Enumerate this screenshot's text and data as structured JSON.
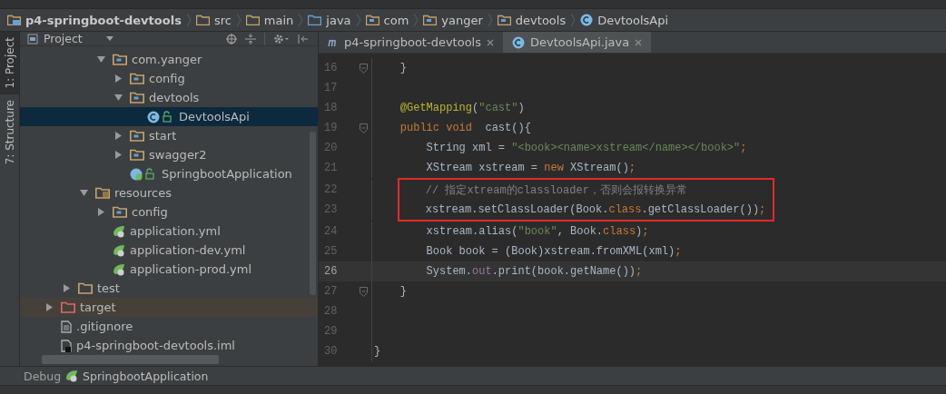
{
  "breadcrumbs": [
    {
      "kind": "project",
      "label": "p4-springboot-devtools"
    },
    {
      "kind": "folder",
      "label": "src"
    },
    {
      "kind": "folder",
      "label": "main"
    },
    {
      "kind": "source",
      "label": "java"
    },
    {
      "kind": "package",
      "label": "com"
    },
    {
      "kind": "package",
      "label": "yanger"
    },
    {
      "kind": "package",
      "label": "devtools"
    },
    {
      "kind": "class",
      "label": "DevtoolsApi"
    }
  ],
  "tool_strip": [
    {
      "label": "1: Project",
      "selected": true
    },
    {
      "label": "7: Structure",
      "selected": false
    }
  ],
  "project_panel": {
    "title": "Project",
    "tree": [
      {
        "children": [
          {
            "children": [
              {
                "children": [
                  {
                    "kind": "package",
                    "label": "com.yanger",
                    "expanded": true,
                    "selected": false,
                    "children": [
                      {
                        "kind": "package",
                        "label": "config",
                        "expanded": false,
                        "selected": false
                      },
                      {
                        "kind": "package",
                        "label": "devtools",
                        "expanded": true,
                        "selected": false,
                        "children": [
                          {
                            "kind": "class",
                            "label": "DevtoolsApi",
                            "selected": true
                          }
                        ]
                      },
                      {
                        "kind": "package",
                        "label": "start",
                        "expanded": false,
                        "selected": false
                      },
                      {
                        "kind": "package",
                        "label": "swagger2",
                        "expanded": false,
                        "selected": false
                      },
                      {
                        "kind": "spring-class",
                        "label": "SpringbootApplication",
                        "selected": false
                      }
                    ]
                  }
                ]
              },
              {
                "kind": "resources",
                "label": "resources",
                "expanded": true,
                "selected": false,
                "children": [
                  {
                    "kind": "package",
                    "label": "config",
                    "expanded": false,
                    "selected": false
                  },
                  {
                    "kind": "spring-config",
                    "label": "application.yml",
                    "selected": false
                  },
                  {
                    "kind": "spring-config",
                    "label": "application-dev.yml",
                    "selected": false
                  },
                  {
                    "kind": "spring-config",
                    "label": "application-prod.yml",
                    "selected": false
                  }
                ]
              }
            ]
          },
          {
            "kind": "folder",
            "label": "test",
            "expanded": false,
            "selected": false
          }
        ]
      },
      {
        "kind": "excluded",
        "label": "target",
        "expanded": false,
        "selected": false
      },
      {
        "kind": "text-file",
        "label": ".gitignore",
        "selected": false
      },
      {
        "kind": "iml-file",
        "label": "p4-springboot-devtools.iml",
        "selected": false
      }
    ]
  },
  "editor_tabs": [
    {
      "kind": "module",
      "label": "p4-springboot-devtools",
      "selected": false
    },
    {
      "kind": "class",
      "label": "DevtoolsApi.java",
      "selected": true
    }
  ],
  "code": {
    "lines": [
      {
        "number": "16",
        "fold": true,
        "boxed": false,
        "current": false,
        "segments": [
          {
            "kind": "plain",
            "text": "    }"
          }
        ]
      },
      {
        "number": "17",
        "fold": false,
        "boxed": false,
        "current": false
      },
      {
        "number": "18",
        "fold": false,
        "boxed": false,
        "current": false,
        "segments": [
          {
            "kind": "annotation",
            "text": "    @GetMapping"
          },
          {
            "kind": "plain",
            "text": "("
          },
          {
            "kind": "string",
            "text": "\"cast\""
          },
          {
            "kind": "plain",
            "text": ")"
          }
        ]
      },
      {
        "number": "19",
        "fold": true,
        "boxed": false,
        "current": false,
        "segments": [
          {
            "kind": "keyword",
            "text": "    public void "
          },
          {
            "kind": "plain",
            "text": " cast(){"
          }
        ]
      },
      {
        "number": "20",
        "fold": false,
        "boxed": false,
        "current": false,
        "segments": [
          {
            "kind": "plain",
            "text": "        String xml = "
          },
          {
            "kind": "string",
            "text": "\"<book><name>xstream</name></book>\""
          },
          {
            "kind": "keyword",
            "text": ";"
          }
        ]
      },
      {
        "number": "21",
        "fold": false,
        "boxed": false,
        "current": false,
        "segments": [
          {
            "kind": "plain",
            "text": "        XStream xstream = "
          },
          {
            "kind": "keyword",
            "text": "new "
          },
          {
            "kind": "plain",
            "text": "XStream()"
          },
          {
            "kind": "keyword",
            "text": ";"
          }
        ]
      },
      {
        "number": "22",
        "fold": false,
        "boxed": true,
        "current": false,
        "segments": [
          {
            "kind": "comment",
            "text": "        // 指定xtream的classloader，否则会报转换异常"
          }
        ]
      },
      {
        "number": "23",
        "fold": false,
        "boxed": true,
        "current": false,
        "segments": [
          {
            "kind": "plain",
            "text": "        xstream.setClassLoader(Book."
          },
          {
            "kind": "keyword",
            "text": "class"
          },
          {
            "kind": "plain",
            "text": ".getClassLoader())"
          },
          {
            "kind": "keyword",
            "text": ";"
          }
        ]
      },
      {
        "number": "24",
        "fold": false,
        "boxed": false,
        "current": false,
        "segments": [
          {
            "kind": "plain",
            "text": "        xstream.alias("
          },
          {
            "kind": "string",
            "text": "\"book\""
          },
          {
            "kind": "plain",
            "text": ", Book."
          },
          {
            "kind": "keyword",
            "text": "class"
          },
          {
            "kind": "plain",
            "text": ")"
          },
          {
            "kind": "keyword",
            "text": ";"
          }
        ]
      },
      {
        "number": "25",
        "fold": false,
        "boxed": false,
        "current": false,
        "segments": [
          {
            "kind": "plain",
            "text": "        Book book = (Book)xstream.fromXML(xml)"
          },
          {
            "kind": "keyword",
            "text": ";"
          }
        ]
      },
      {
        "number": "26",
        "fold": false,
        "boxed": false,
        "current": true,
        "segments": [
          {
            "kind": "plain",
            "text": "        System."
          },
          {
            "kind": "field",
            "text": "out"
          },
          {
            "kind": "plain",
            "text": ".print(book.getName())"
          },
          {
            "kind": "keyword",
            "text": ";"
          }
        ]
      },
      {
        "number": "27",
        "fold": true,
        "boxed": false,
        "current": false,
        "segments": [
          {
            "kind": "plain",
            "text": "    }"
          }
        ]
      },
      {
        "number": "28",
        "fold": false,
        "boxed": false,
        "current": false
      },
      {
        "number": "29",
        "fold": false,
        "boxed": false,
        "current": false
      },
      {
        "number": "30",
        "fold": false,
        "boxed": false,
        "current": false,
        "segments": [
          {
            "kind": "plain",
            "text": "}"
          }
        ]
      }
    ]
  },
  "debug_bar": {
    "title": "Debug",
    "config": "SpringbootApplication"
  }
}
